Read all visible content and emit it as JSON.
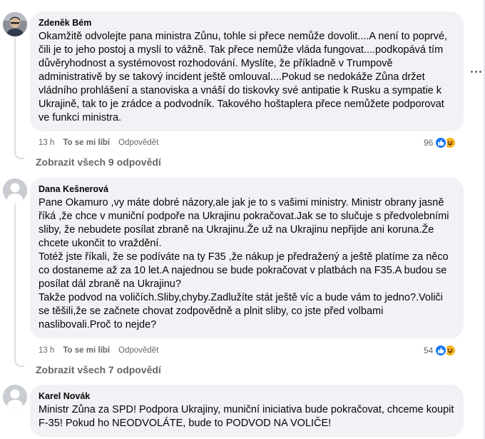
{
  "comments": [
    {
      "author": "Zdeněk Bém",
      "paragraphs": [
        "Okamžitě odvolejte pana ministra Zůnu, tohle si přece nemůže dovolit....A není to poprvé, čili je to jeho postoj a myslí to vážně. Tak přece nemůže vláda fungovat....podkopává tím důvěryhodnost a systémovost rozhodování. Myslíte, že příkladně v Trumpově administrativě by se takový incident ještě omlouval....Pokud se nedokáže Zůna držet vládního prohlášení a stanoviska a vnáší do tiskovky své antipatie k Rusku a sympatie k Ukrajině, tak to je zrádce a podvodník. Takového hoštaplera přece nemůžete podporovat ve funkci ministra."
      ],
      "time": "13 h",
      "dislike": "To se mi líbí",
      "reply": "Odpovědět",
      "reaction_count": "96",
      "view_replies": "Zobrazit všech 9 odpovědí"
    },
    {
      "author": "Dana Kešnerová",
      "paragraphs": [
        "Pane Okamuro ,vy máte dobré názory,ale jak je to s vašimi ministry. Ministr obrany jasně říká ,že chce v muniční podpoře na Ukrajinu pokračovat.Jak se to slučuje s předvolebními sliby, že nebudete posílat zbraně na Ukrajinu.Že už na Ukrajinu nepřijde ani koruna.Že chcete ukončit to vraždění.",
        "Totéž jste říkali, že se podíváte na ty F35 ,že nákup je předražený a ještě platíme za něco co dostaneme až za 10 let.A najednou se bude pokračovat v platbách na F35.A budou se posílat dál zbraně na Ukrajinu?",
        "Takže podvod na voličích.Sliby,chyby.Zadlužíte stát ještě víc a bude vám to jedno?.Voliči se těšili,že se začnete chovat zodpovědně a plnit sliby, co jste před volbami naslibovali.Proč to nejde?"
      ],
      "time": "13 h",
      "dislike": "To se mi líbí",
      "reply": "Odpovědět",
      "reaction_count": "54",
      "view_replies": "Zobrazit všech 7 odpovědí"
    },
    {
      "author": "Karel Novák",
      "paragraphs": [
        "Ministr Zůna za SPD! Podpora Ukrajiny, muniční iniciativa bude pokračovat, chceme koupit F-35! Pokud ho NEODVOLÁTE, bude to PODVOD NA VOLIČE!"
      ]
    }
  ],
  "icons": {
    "like": "like-icon",
    "haha": "haha-icon",
    "more": "more-options-icon",
    "avatar_default": "default-avatar-icon"
  },
  "colors": {
    "bubble": "#f0f2f5",
    "like_blue": "#1877f2",
    "haha_yellow": "#f7b125",
    "meta_gray": "#65676b"
  }
}
